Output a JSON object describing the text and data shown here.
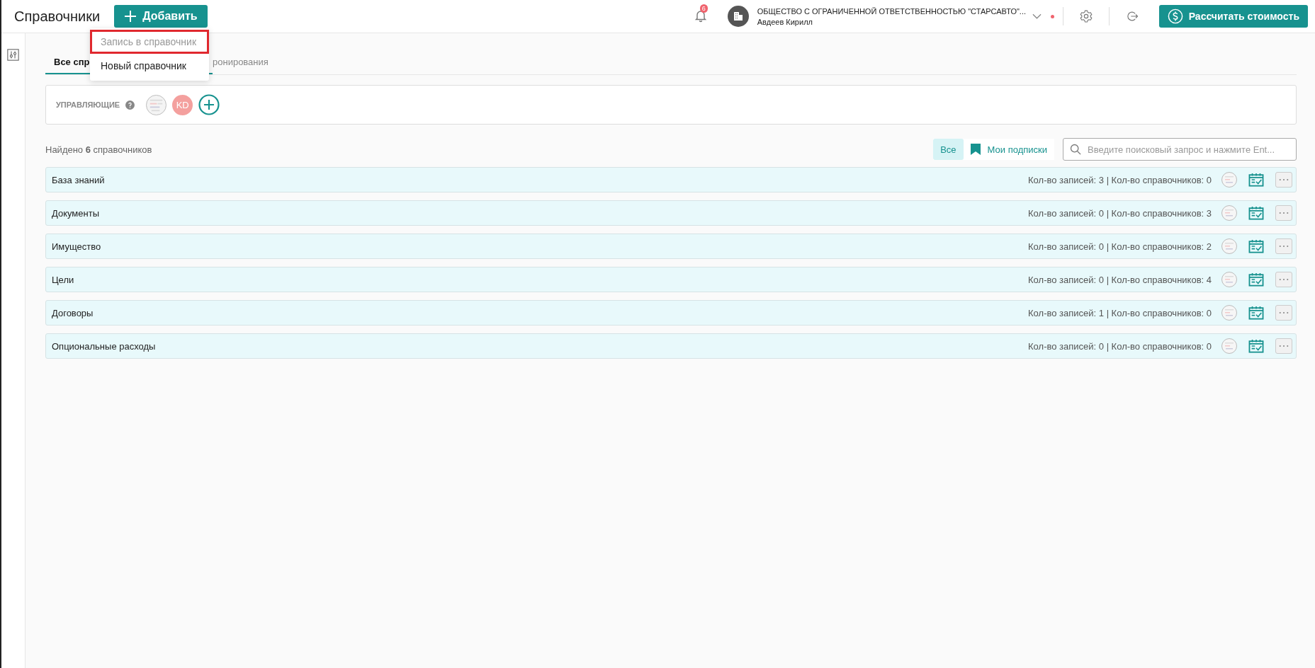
{
  "header": {
    "title": "Справочники",
    "add_button": "Добавить",
    "notifications_count": "6",
    "organization": "ОБЩЕСТВО С ОГРАНИЧЕННОЙ ОТВЕТСТВЕННОСТЬЮ \"СТАРСАВТО\"...",
    "user": "Авдеев Кирилл",
    "calc_button": "Рассчитать стоимость"
  },
  "add_menu": [
    {
      "label": "Запись в справочник",
      "disabled": true,
      "highlighted": true
    },
    {
      "label": "Новый справочник",
      "disabled": false,
      "highlighted": false
    }
  ],
  "tabs": [
    {
      "label": "Все спр",
      "selected": true
    },
    {
      "label": "ронирования",
      "selected": false
    }
  ],
  "managers": {
    "label": "УПРАВЛЯЮЩИЕ",
    "avatars": [
      {
        "kind": "picture"
      },
      {
        "kind": "initials",
        "text": "KD"
      }
    ]
  },
  "found": "Найдено **6** справочников",
  "filters": [
    {
      "label": "Все",
      "selected": true
    },
    {
      "label": "Мои подписки",
      "selected": false
    }
  ],
  "search": {
    "placeholder": "Введите поисковый запрос и нажмите Ent..."
  },
  "directories": [
    {
      "name": "База знаний",
      "stats": "Кол-во записей: 3 | Кол-во справочников: 0"
    },
    {
      "name": "Документы",
      "stats": "Кол-во записей: 0 | Кол-во справочников: 3"
    },
    {
      "name": "Имущество",
      "stats": "Кол-во записей: 0 | Кол-во справочников: 2"
    },
    {
      "name": "Цели",
      "stats": "Кол-во записей: 0 | Кол-во справочников: 4"
    },
    {
      "name": "Договоры",
      "stats": "Кол-во записей: 1 | Кол-во справочников: 0"
    },
    {
      "name": "Опциональные расходы",
      "stats": "Кол-во записей: 0 | Кол-во справочников: 0"
    }
  ]
}
